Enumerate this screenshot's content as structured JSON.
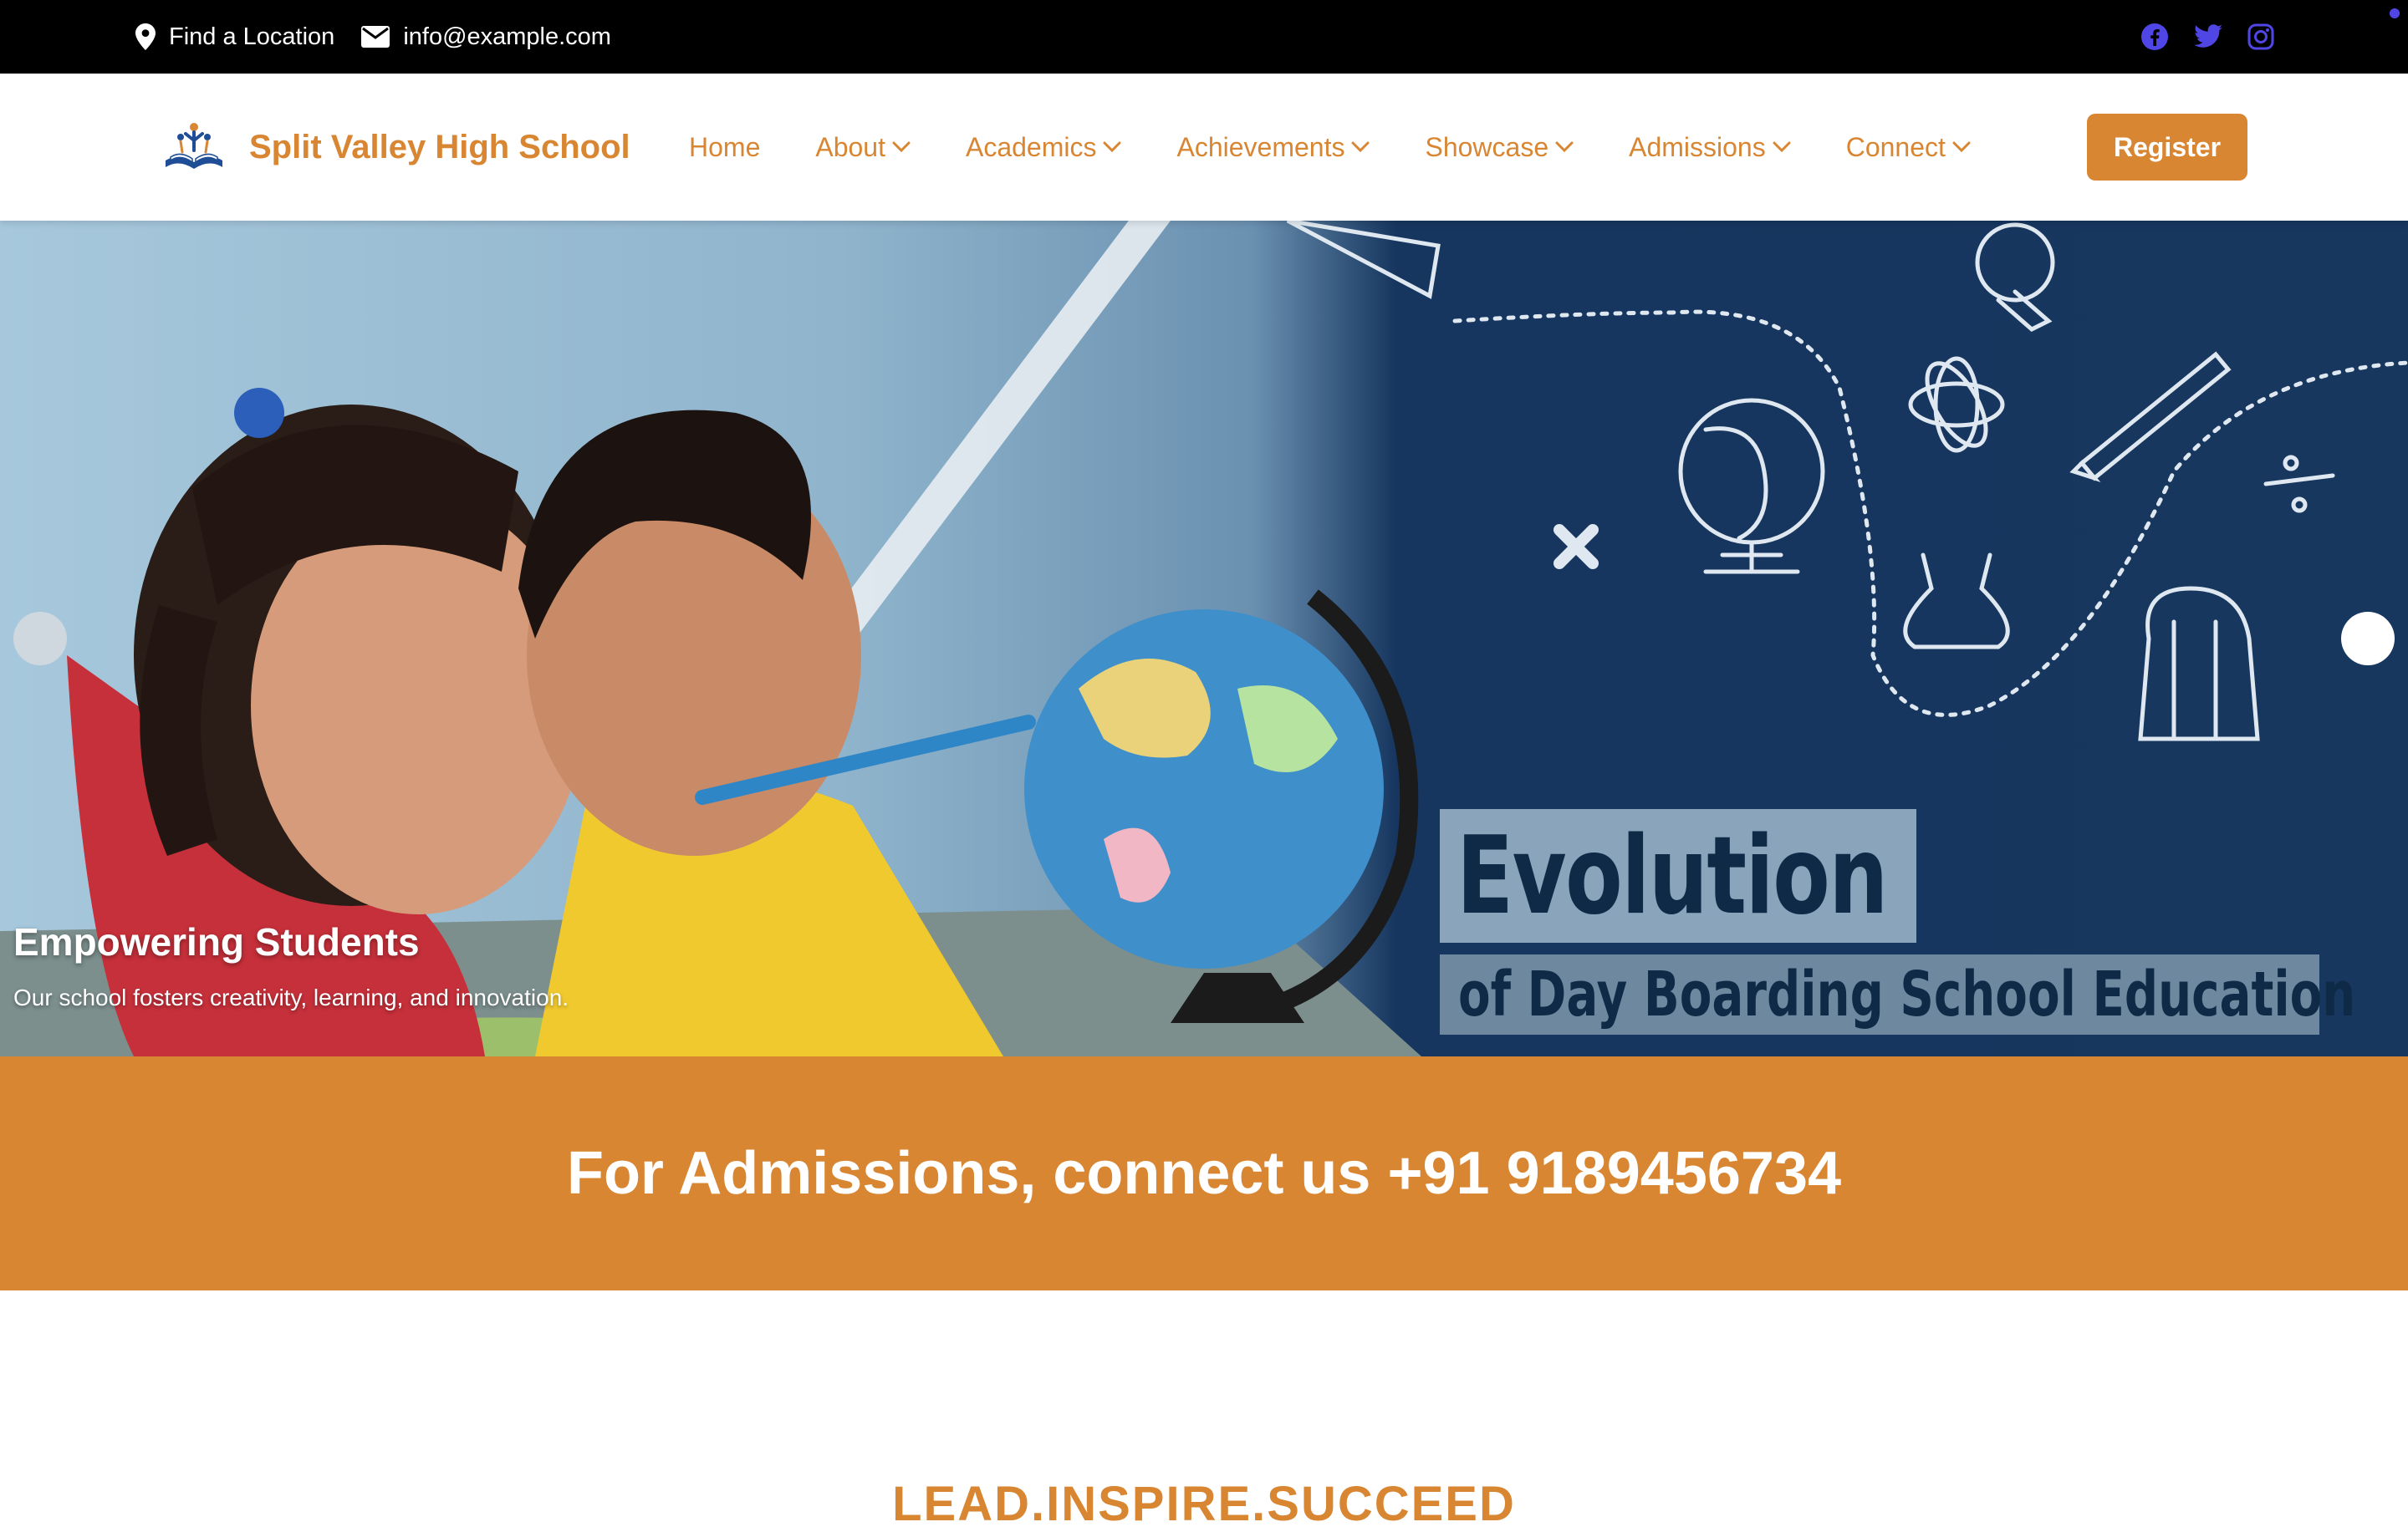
{
  "topbar": {
    "location_label": "Find a Location",
    "email_label": "info@example.com",
    "social": [
      "facebook-icon",
      "twitter-icon",
      "instagram-icon"
    ],
    "social_color": "#4f46e5"
  },
  "nav": {
    "brand_name": "Split Valley High School",
    "items": [
      {
        "label": "Home",
        "dropdown": false
      },
      {
        "label": "About",
        "dropdown": true
      },
      {
        "label": "Academics",
        "dropdown": true
      },
      {
        "label": "Achievements",
        "dropdown": true
      },
      {
        "label": "Showcase",
        "dropdown": true
      },
      {
        "label": "Admissions",
        "dropdown": true
      },
      {
        "label": "Connect",
        "dropdown": true
      }
    ],
    "register_label": "Register"
  },
  "hero": {
    "image_text_title": "Evolution",
    "image_text_sub": "of Day Boarding School Education",
    "caption_title": "Empowering Students",
    "caption_sub": "Our school fosters creativity, learning, and innovation."
  },
  "banner": {
    "text": "For Admissions, connect us +91 9189456734"
  },
  "section": {
    "title": "LEAD.INSPIRE.SUCCEED"
  },
  "colors": {
    "brand": "#d98633",
    "topbar_bg": "#000000",
    "hero_dark": "#17375f"
  }
}
